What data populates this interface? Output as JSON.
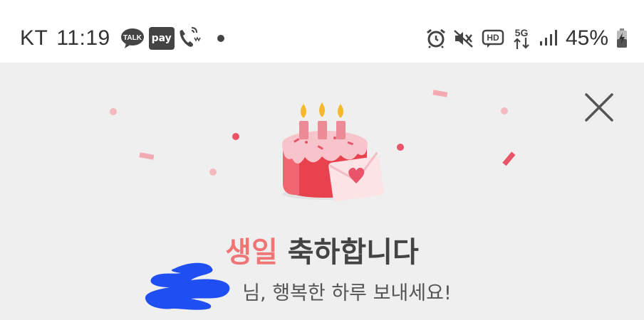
{
  "status_bar": {
    "carrier": "KT",
    "time": "11:19",
    "left_icons": [
      "talk-icon",
      "pay-icon",
      "whowho-icon",
      "notification-dot-icon"
    ],
    "pay_label": "pay",
    "talk_label": "TALK",
    "right_icons": [
      "alarm-icon",
      "vibrate-mute-icon",
      "hd-voice-icon",
      "5g-icon",
      "signal-icon",
      "battery-charging-icon"
    ],
    "hd_label": "HD",
    "network_label": "5G",
    "battery_percent": "45%"
  },
  "popup": {
    "close_icon": "close-icon",
    "illustration": "birthday-cake-with-heart-envelope",
    "title_accent": "생일",
    "title_rest": " 축하합니다",
    "subtitle": "님, 행복한 하루 보내세요!"
  },
  "colors": {
    "background": "#efefef",
    "accent": "#f07575",
    "redaction": "#1f4ef2"
  }
}
